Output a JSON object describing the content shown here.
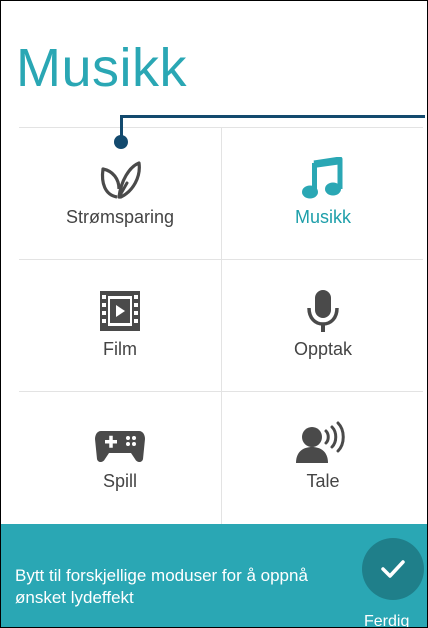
{
  "header": {
    "title": "Musikk"
  },
  "modes": [
    {
      "label": "Strømsparing",
      "icon": "leaf-icon",
      "active": false
    },
    {
      "label": "Musikk",
      "icon": "music-note-icon",
      "active": true
    },
    {
      "label": "Film",
      "icon": "film-icon",
      "active": false
    },
    {
      "label": "Opptak",
      "icon": "microphone-icon",
      "active": false
    },
    {
      "label": "Spill",
      "icon": "gamepad-icon",
      "active": false
    },
    {
      "label": "Tale",
      "icon": "speaking-person-icon",
      "active": false
    }
  ],
  "hint": {
    "text": "Bytt til forskjellige moduser for å oppnå ønsket lydeffekt",
    "done_label": "Ferdig",
    "done_icon": "checkmark-icon"
  },
  "colors": {
    "accent": "#2aa7b4",
    "accent_dark": "#1f7f8a",
    "active_label": "#1e9faa",
    "icon_gray": "#4a4a4a",
    "callout": "#134a6e"
  }
}
